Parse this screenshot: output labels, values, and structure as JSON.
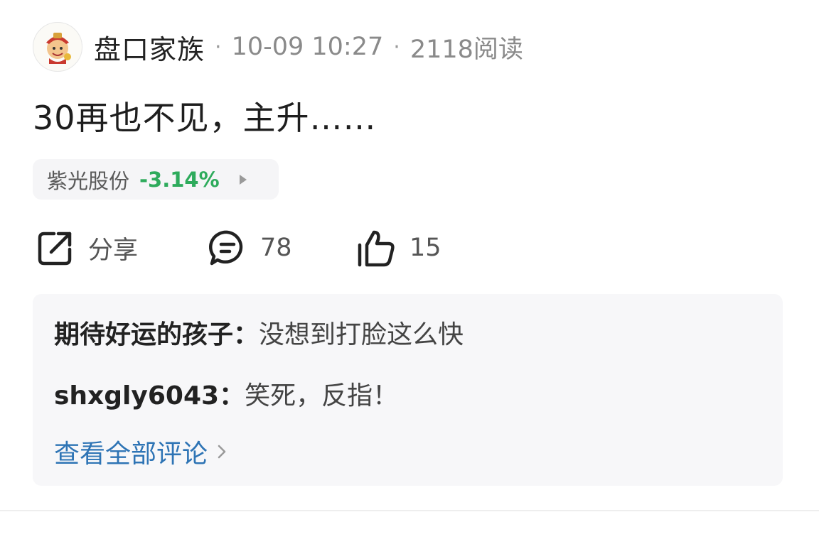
{
  "post": {
    "author": "盘口家族",
    "separator_1": "·",
    "time": "10-09 10:27",
    "separator_2": "·",
    "views": "2118阅读",
    "title": "30再也不见，主升……"
  },
  "stock": {
    "name": "紫光股份",
    "change": "-3.14%",
    "change_color": "#2eab5c"
  },
  "actions": {
    "share_label": "分享",
    "comment_count": "78",
    "like_count": "15"
  },
  "comments": [
    {
      "user": "期待好运的孩子",
      "separator": "：",
      "text": "没想到打脸这么快"
    },
    {
      "user": "shxgly6043",
      "separator": "：",
      "text": "笑死，反指！"
    }
  ],
  "view_all_label": "查看全部评论",
  "colors": {
    "link": "#2e74b5",
    "negative": "#2eab5c"
  }
}
